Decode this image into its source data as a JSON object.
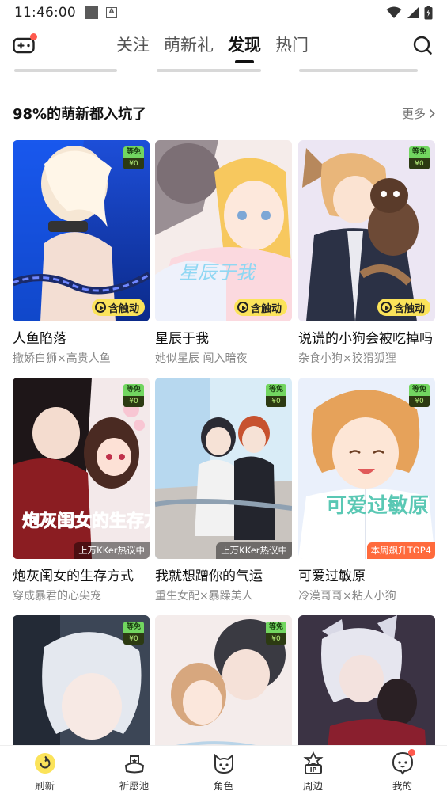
{
  "status_bar": {
    "time": "11:46:00",
    "notif_letter": "A"
  },
  "top_nav": {
    "tabs": [
      {
        "label": "关注",
        "active": false
      },
      {
        "label": "萌新礼",
        "active": false
      },
      {
        "label": "发现",
        "active": true
      },
      {
        "label": "热门",
        "active": false
      }
    ]
  },
  "section": {
    "title": "98%的萌新都入坑了",
    "more_label": "更多"
  },
  "cards": [
    {
      "title": "人鱼陷落",
      "subtitle": "撒娇白狮×高贵人鱼",
      "badge_top": "等免",
      "badge_bottom": "¥0",
      "tag": "含触动",
      "tag_type": "pill"
    },
    {
      "title": "星辰于我",
      "subtitle": "她似星辰 闯入暗夜",
      "badge_top": "",
      "badge_bottom": "",
      "tag": "含触动",
      "tag_type": "pill"
    },
    {
      "title": "说谎的小狗会被吃掉吗",
      "subtitle": "杂食小狗×狡猾狐狸",
      "badge_top": "等免",
      "badge_bottom": "¥0",
      "tag": "含触动",
      "tag_type": "pill"
    },
    {
      "title": "炮灰闺女的生存方式",
      "subtitle": "穿成暴君的心尖宠",
      "badge_top": "等免",
      "badge_bottom": "¥0",
      "tag": "上万KKer热议中",
      "tag_type": "hot"
    },
    {
      "title": "我就想蹭你的气运",
      "subtitle": "重生女配×暴躁美人",
      "badge_top": "等免",
      "badge_bottom": "¥0",
      "tag": "上万KKer热议中",
      "tag_type": "hot"
    },
    {
      "title": "可爱过敏原",
      "subtitle": "冷漠哥哥×粘人小狗",
      "badge_top": "等免",
      "badge_bottom": "¥0",
      "tag": "本周飙升TOP4",
      "tag_type": "rank"
    },
    {
      "title": "",
      "subtitle": "",
      "badge_top": "等免",
      "badge_bottom": "¥0",
      "tag": "",
      "tag_type": ""
    },
    {
      "title": "",
      "subtitle": "",
      "badge_top": "等免",
      "badge_bottom": "¥0",
      "tag": "",
      "tag_type": ""
    },
    {
      "title": "",
      "subtitle": "",
      "badge_top": "",
      "badge_bottom": "",
      "tag": "",
      "tag_type": ""
    }
  ],
  "cover_text": {
    "xingchen": "星辰于我",
    "paohui": "炮灰闺女的生存方式",
    "keai": "可爱过敏原"
  },
  "bottom_nav": [
    {
      "label": "刷新",
      "icon": "refresh-icon",
      "active": true
    },
    {
      "label": "祈愿池",
      "icon": "wish-pool-icon",
      "active": false
    },
    {
      "label": "角色",
      "icon": "character-icon",
      "active": false
    },
    {
      "label": "周边",
      "icon": "merch-icon",
      "active": false,
      "icon_text": "IP"
    },
    {
      "label": "我的",
      "icon": "profile-icon",
      "active": false,
      "dot": true
    }
  ],
  "colors": {
    "accent": "#fbe35a",
    "badge_green": "#72d660",
    "dot_red": "#ff5a4e",
    "rank_orange": "#ff6a3c"
  }
}
